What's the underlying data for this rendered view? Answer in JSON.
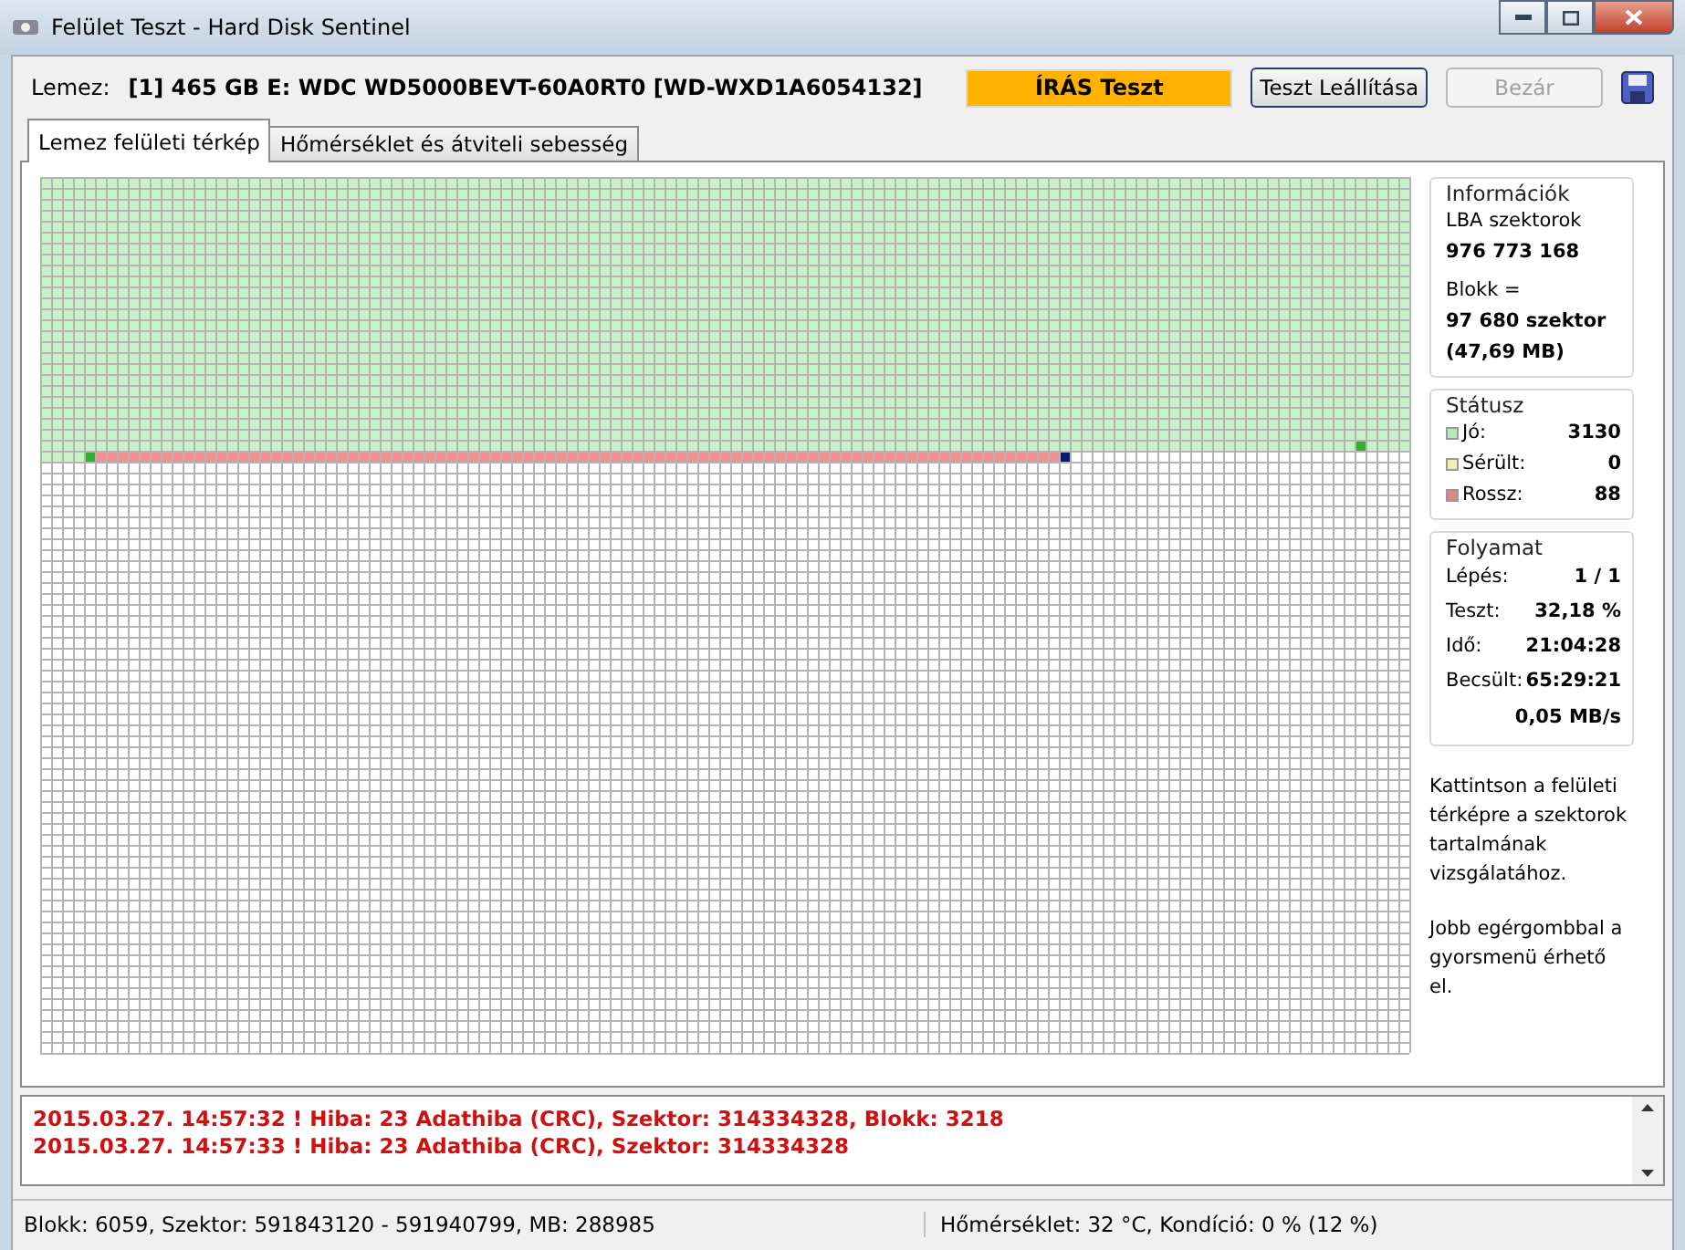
{
  "window": {
    "title": "Felület Teszt - Hard Disk Sentinel"
  },
  "header": {
    "disk_label": "Lemez:",
    "disk_name": "[1] 465 GB E: WDC WD5000BEVT-60A0RT0 [WD-WXD1A6054132]",
    "mode": "ÍRÁS Teszt",
    "buttons": [
      {
        "label": "Teszt Leállítása",
        "disabled": false
      },
      {
        "label": "Bezár",
        "disabled": true
      }
    ]
  },
  "tabs": [
    {
      "label": "Lemez felületi térkép",
      "selected": true
    },
    {
      "label": "Hőmérséklet és átviteli sebesség",
      "selected": false
    }
  ],
  "info": {
    "title": "Információk",
    "lba_label": "LBA szektorok",
    "lba_value": "976 773 168",
    "block_label": "Blokk =",
    "block_value": "97 680 szektor",
    "block_size": "(47,69 MB)"
  },
  "status": {
    "title": "Státusz",
    "items": [
      {
        "label": "Jó:",
        "value": "3130",
        "color": "#b8e8b8"
      },
      {
        "label": "Sérült:",
        "value": "0",
        "color": "#f0f0b0"
      },
      {
        "label": "Rossz:",
        "value": "88",
        "color": "#e08888"
      }
    ]
  },
  "progress": {
    "title": "Folyamat",
    "rows": [
      {
        "label": "Lépés:",
        "value": "1 / 1"
      },
      {
        "label": "Teszt:",
        "value": "32,18 %"
      },
      {
        "label": "Idő:",
        "value": "21:04:28"
      },
      {
        "label": "Becsült:",
        "value": "65:29:21"
      }
    ],
    "speed": "0,05 MB/s"
  },
  "hints": [
    "Kattintson a felületi térképre a szektorok tartalmának vizsgálatához.",
    "Jobb egérgombbal a gyorsmenü érhető el."
  ],
  "log": [
    "2015.03.27.  14:57:32 ! Hiba: 23 Adathiba (CRC), Szektor: 314334328, Blokk: 3218",
    "2015.03.27.  14:57:33 ! Hiba: 23 Adathiba (CRC), Szektor: 314334328"
  ],
  "status_bar": {
    "left": "Blokk: 6059, Szektor: 591843120 - 591940799, MB: 288985",
    "right": "Hőmérséklet: 32  °C,  Kondíció: 0 % (12 %)"
  }
}
